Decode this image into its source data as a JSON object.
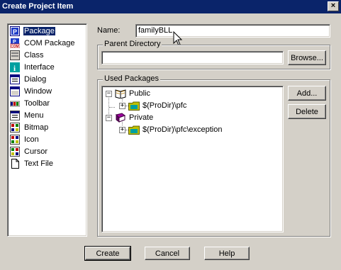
{
  "window": {
    "title": "Create Project Item",
    "close_glyph": "×"
  },
  "types": {
    "selected": "Package",
    "items": [
      {
        "label": "Package",
        "icon": "package-icon"
      },
      {
        "label": "COM Package",
        "icon": "com-package-icon"
      },
      {
        "label": "Class",
        "icon": "class-icon"
      },
      {
        "label": "Interface",
        "icon": "interface-icon"
      },
      {
        "label": "Dialog",
        "icon": "dialog-icon"
      },
      {
        "label": "Window",
        "icon": "window-icon"
      },
      {
        "label": "Toolbar",
        "icon": "toolbar-icon"
      },
      {
        "label": "Menu",
        "icon": "menu-icon"
      },
      {
        "label": "Bitmap",
        "icon": "bitmap-icon"
      },
      {
        "label": "Icon",
        "icon": "icon-icon"
      },
      {
        "label": "Cursor",
        "icon": "cursor-icon"
      },
      {
        "label": "Text File",
        "icon": "text-file-icon"
      }
    ]
  },
  "name": {
    "label": "Name:",
    "value": "familyBLL"
  },
  "parent_directory": {
    "label": "Parent Directory",
    "value": "",
    "browse_label": "Browse..."
  },
  "used_packages": {
    "label": "Used Packages",
    "groups": [
      {
        "label": "Public",
        "children": [
          "$(ProDir)\\pfc"
        ]
      },
      {
        "label": "Private",
        "children": [
          "$(ProDir)\\pfc\\exception"
        ]
      }
    ],
    "add_label": "Add...",
    "delete_label": "Delete"
  },
  "footer": {
    "create_label": "Create",
    "cancel_label": "Cancel",
    "help_label": "Help"
  },
  "colors": {
    "title_bar": "#0a246a",
    "face": "#d4d0c8",
    "selection": "#0a246a"
  }
}
